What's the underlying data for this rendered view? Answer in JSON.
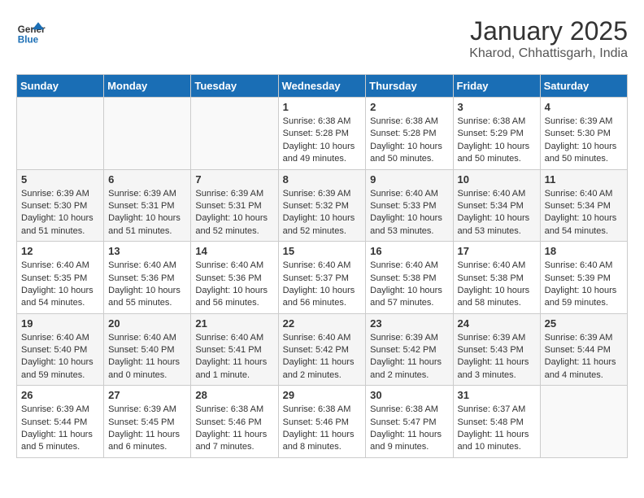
{
  "header": {
    "logo_line1": "General",
    "logo_line2": "Blue",
    "month": "January 2025",
    "location": "Kharod, Chhattisgarh, India"
  },
  "weekdays": [
    "Sunday",
    "Monday",
    "Tuesday",
    "Wednesday",
    "Thursday",
    "Friday",
    "Saturday"
  ],
  "weeks": [
    [
      {
        "day": "",
        "info": ""
      },
      {
        "day": "",
        "info": ""
      },
      {
        "day": "",
        "info": ""
      },
      {
        "day": "1",
        "info": "Sunrise: 6:38 AM\nSunset: 5:28 PM\nDaylight: 10 hours\nand 49 minutes."
      },
      {
        "day": "2",
        "info": "Sunrise: 6:38 AM\nSunset: 5:28 PM\nDaylight: 10 hours\nand 50 minutes."
      },
      {
        "day": "3",
        "info": "Sunrise: 6:38 AM\nSunset: 5:29 PM\nDaylight: 10 hours\nand 50 minutes."
      },
      {
        "day": "4",
        "info": "Sunrise: 6:39 AM\nSunset: 5:30 PM\nDaylight: 10 hours\nand 50 minutes."
      }
    ],
    [
      {
        "day": "5",
        "info": "Sunrise: 6:39 AM\nSunset: 5:30 PM\nDaylight: 10 hours\nand 51 minutes."
      },
      {
        "day": "6",
        "info": "Sunrise: 6:39 AM\nSunset: 5:31 PM\nDaylight: 10 hours\nand 51 minutes."
      },
      {
        "day": "7",
        "info": "Sunrise: 6:39 AM\nSunset: 5:31 PM\nDaylight: 10 hours\nand 52 minutes."
      },
      {
        "day": "8",
        "info": "Sunrise: 6:39 AM\nSunset: 5:32 PM\nDaylight: 10 hours\nand 52 minutes."
      },
      {
        "day": "9",
        "info": "Sunrise: 6:40 AM\nSunset: 5:33 PM\nDaylight: 10 hours\nand 53 minutes."
      },
      {
        "day": "10",
        "info": "Sunrise: 6:40 AM\nSunset: 5:34 PM\nDaylight: 10 hours\nand 53 minutes."
      },
      {
        "day": "11",
        "info": "Sunrise: 6:40 AM\nSunset: 5:34 PM\nDaylight: 10 hours\nand 54 minutes."
      }
    ],
    [
      {
        "day": "12",
        "info": "Sunrise: 6:40 AM\nSunset: 5:35 PM\nDaylight: 10 hours\nand 54 minutes."
      },
      {
        "day": "13",
        "info": "Sunrise: 6:40 AM\nSunset: 5:36 PM\nDaylight: 10 hours\nand 55 minutes."
      },
      {
        "day": "14",
        "info": "Sunrise: 6:40 AM\nSunset: 5:36 PM\nDaylight: 10 hours\nand 56 minutes."
      },
      {
        "day": "15",
        "info": "Sunrise: 6:40 AM\nSunset: 5:37 PM\nDaylight: 10 hours\nand 56 minutes."
      },
      {
        "day": "16",
        "info": "Sunrise: 6:40 AM\nSunset: 5:38 PM\nDaylight: 10 hours\nand 57 minutes."
      },
      {
        "day": "17",
        "info": "Sunrise: 6:40 AM\nSunset: 5:38 PM\nDaylight: 10 hours\nand 58 minutes."
      },
      {
        "day": "18",
        "info": "Sunrise: 6:40 AM\nSunset: 5:39 PM\nDaylight: 10 hours\nand 59 minutes."
      }
    ],
    [
      {
        "day": "19",
        "info": "Sunrise: 6:40 AM\nSunset: 5:40 PM\nDaylight: 10 hours\nand 59 minutes."
      },
      {
        "day": "20",
        "info": "Sunrise: 6:40 AM\nSunset: 5:40 PM\nDaylight: 11 hours\nand 0 minutes."
      },
      {
        "day": "21",
        "info": "Sunrise: 6:40 AM\nSunset: 5:41 PM\nDaylight: 11 hours\nand 1 minute."
      },
      {
        "day": "22",
        "info": "Sunrise: 6:40 AM\nSunset: 5:42 PM\nDaylight: 11 hours\nand 2 minutes."
      },
      {
        "day": "23",
        "info": "Sunrise: 6:39 AM\nSunset: 5:42 PM\nDaylight: 11 hours\nand 2 minutes."
      },
      {
        "day": "24",
        "info": "Sunrise: 6:39 AM\nSunset: 5:43 PM\nDaylight: 11 hours\nand 3 minutes."
      },
      {
        "day": "25",
        "info": "Sunrise: 6:39 AM\nSunset: 5:44 PM\nDaylight: 11 hours\nand 4 minutes."
      }
    ],
    [
      {
        "day": "26",
        "info": "Sunrise: 6:39 AM\nSunset: 5:44 PM\nDaylight: 11 hours\nand 5 minutes."
      },
      {
        "day": "27",
        "info": "Sunrise: 6:39 AM\nSunset: 5:45 PM\nDaylight: 11 hours\nand 6 minutes."
      },
      {
        "day": "28",
        "info": "Sunrise: 6:38 AM\nSunset: 5:46 PM\nDaylight: 11 hours\nand 7 minutes."
      },
      {
        "day": "29",
        "info": "Sunrise: 6:38 AM\nSunset: 5:46 PM\nDaylight: 11 hours\nand 8 minutes."
      },
      {
        "day": "30",
        "info": "Sunrise: 6:38 AM\nSunset: 5:47 PM\nDaylight: 11 hours\nand 9 minutes."
      },
      {
        "day": "31",
        "info": "Sunrise: 6:37 AM\nSunset: 5:48 PM\nDaylight: 11 hours\nand 10 minutes."
      },
      {
        "day": "",
        "info": ""
      }
    ]
  ]
}
